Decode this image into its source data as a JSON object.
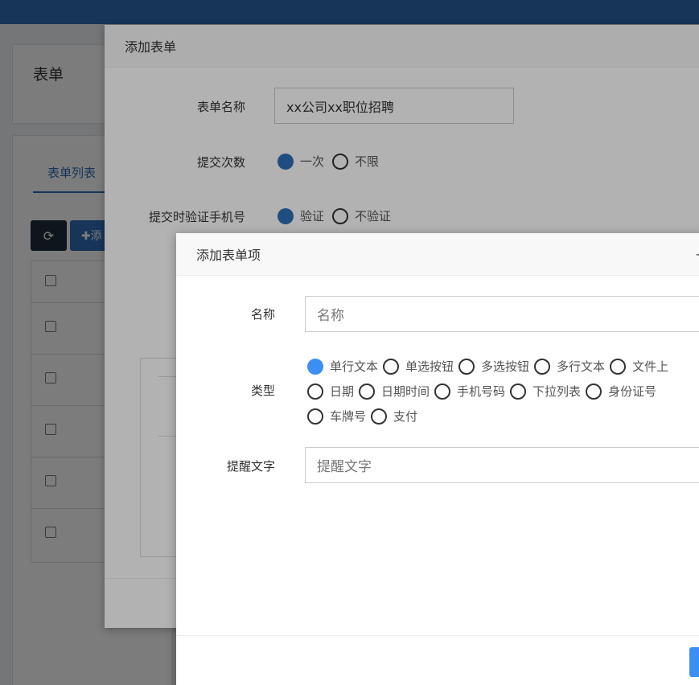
{
  "page": {
    "title": "表单",
    "tab_label": "表单列表",
    "refresh_icon": "refresh-icon",
    "add_button_label": "✚添"
  },
  "modal1": {
    "title": "添加表单",
    "fields": {
      "name_label": "表单名称",
      "name_value": "xx公司xx职位招聘",
      "submit_count_label": "提交次数",
      "submit_count_options": [
        "一次",
        "不限"
      ],
      "submit_count_selected": "一次",
      "verify_phone_label": "提交时验证手机号",
      "verify_phone_options": [
        "验证",
        "不验证"
      ],
      "verify_phone_selected": "验证"
    }
  },
  "modal2": {
    "title": "添加表单项",
    "name_label": "名称",
    "name_placeholder": "名称",
    "type_label": "类型",
    "type_options_row1": [
      "单行文本",
      "单选按钮",
      "多选按钮",
      "多行文本",
      "文件上"
    ],
    "type_options_row2": [
      "日期",
      "日期时间",
      "手机号码",
      "下拉列表",
      "身份证号"
    ],
    "type_options_row3": [
      "车牌号",
      "支付"
    ],
    "type_selected": "单行文本",
    "hint_label": "提醒文字",
    "hint_placeholder": "提醒文字",
    "close_glyph": "—"
  },
  "colors": {
    "accent": "#2f6fb8",
    "selected_radio": "#3b8ff0"
  }
}
